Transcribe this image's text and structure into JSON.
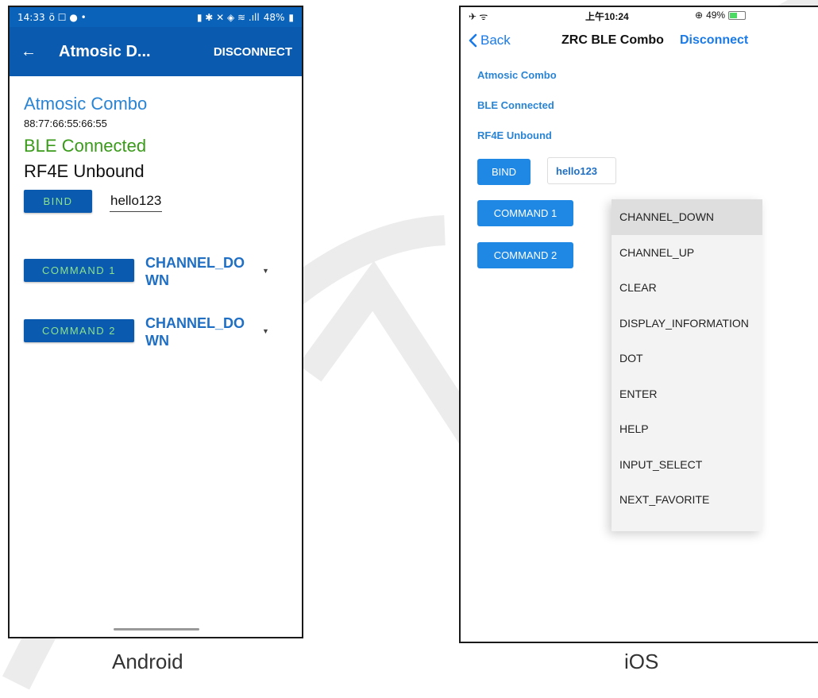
{
  "android": {
    "status": {
      "time": "14:33",
      "left_icons": "ö ☐ ● •",
      "right_icons": "▮ ✱ ✕ ◈ ≋ .ıll",
      "battery": "48%"
    },
    "appbar": {
      "title": "Atmosic D...",
      "disconnect_label": "DISCONNECT"
    },
    "device_name": "Atmosic Combo",
    "mac_address": "88:77:66:55:66:55",
    "ble_status": "BLE Connected",
    "rf4e_status": "RF4E Unbound",
    "bind_label": "BIND",
    "bind_input_value": "hello123",
    "commands": [
      {
        "label": "COMMAND 1",
        "selected": "CHANNEL_DOWN"
      },
      {
        "label": "COMMAND 2",
        "selected": "CHANNEL_DOWN"
      }
    ],
    "colors": {
      "appbar": "#0a5ab0",
      "button_text": "#8be38b",
      "ble_connected": "#3a9a1a"
    }
  },
  "ios": {
    "status": {
      "left_icons": "✈ ᯤ",
      "time": "上午10:24",
      "battery_icon": "⊕",
      "battery": "49%",
      "battery_level": 0.49
    },
    "nav": {
      "back_label": "Back",
      "title": "ZRC BLE Combo",
      "disconnect_label": "Disconnect"
    },
    "device_name": "Atmosic Combo",
    "ble_status": "BLE Connected",
    "rf4e_status": "RF4E Unbound",
    "bind_label": "BIND",
    "bind_input_value": "hello123",
    "commands": [
      {
        "label": "COMMAND 1"
      },
      {
        "label": "COMMAND 2"
      }
    ],
    "dropdown_options": [
      "CHANNEL_DOWN",
      "CHANNEL_UP",
      "CLEAR",
      "DISPLAY_INFORMATION",
      "DOT",
      "ENTER",
      "HELP",
      "INPUT_SELECT",
      "NEXT_FAVORITE"
    ],
    "colors": {
      "accent": "#1a7ae8",
      "button": "#1f88e5"
    }
  },
  "captions": {
    "android": "Android",
    "ios": "iOS"
  }
}
